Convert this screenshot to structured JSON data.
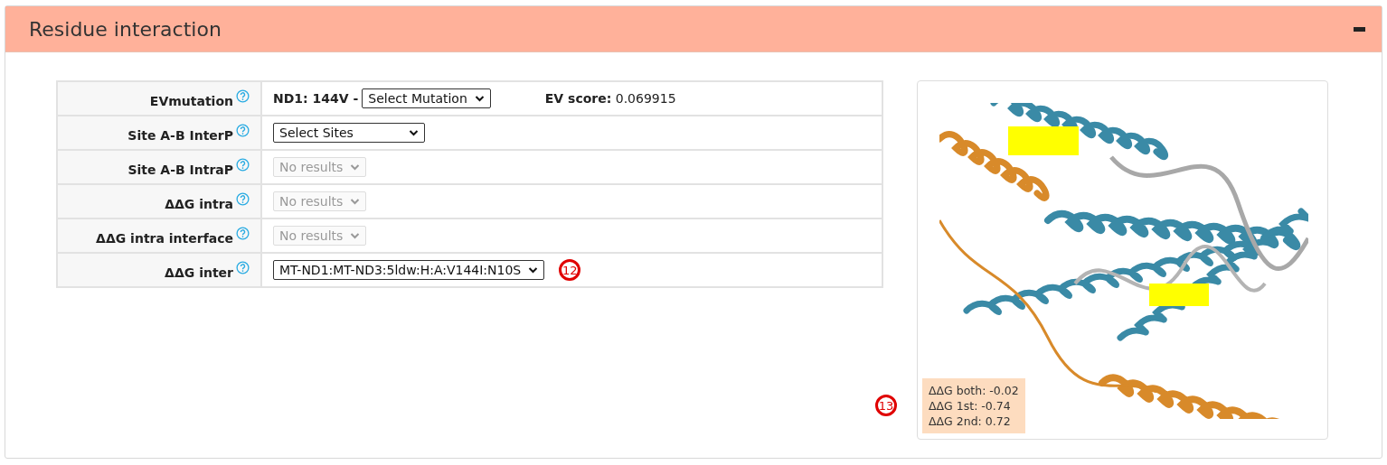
{
  "panel": {
    "title": "Residue interaction",
    "expanded": true
  },
  "rows": [
    {
      "kind": "mutation",
      "label": "EVmutation",
      "prefix": "ND1: 144V -",
      "select": {
        "value": "Select Mutation",
        "disabled": false
      },
      "score_label": "EV score:",
      "score_value": "0.069915"
    },
    {
      "kind": "select",
      "label": "Site A-B InterP",
      "select": {
        "value": "Select Sites",
        "disabled": false
      }
    },
    {
      "kind": "select",
      "label": "Site A-B IntraP",
      "select": {
        "value": "No results",
        "disabled": true
      }
    },
    {
      "kind": "select",
      "label": "ΔΔG intra",
      "select": {
        "value": "No results",
        "disabled": true
      }
    },
    {
      "kind": "select",
      "label": "ΔΔG intra interface",
      "select": {
        "value": "No results",
        "disabled": true
      }
    },
    {
      "kind": "select",
      "label": "ΔΔG inter",
      "select": {
        "value": "MT-ND1:MT-ND3:5ldw:H:A:V144I:N10S",
        "disabled": false
      },
      "callout": "12"
    }
  ],
  "viewer": {
    "kind": "picture",
    "callout": "13",
    "energies": [
      "ΔΔG both: -0.02",
      "ΔΔG 1st: -0.74",
      "ΔΔG 2nd: 0.72"
    ]
  }
}
